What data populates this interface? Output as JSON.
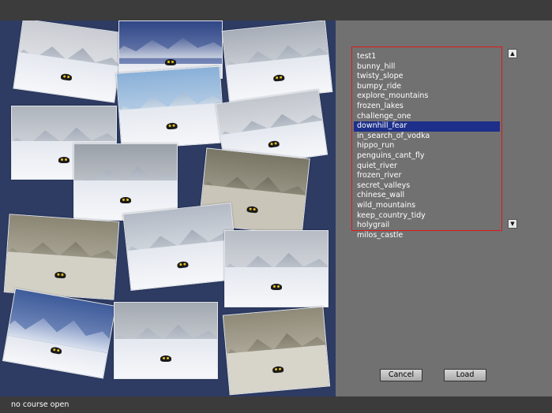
{
  "courses": {
    "items": [
      "test1",
      "bunny_hill",
      "twisty_slope",
      "bumpy_ride",
      "explore_mountains",
      "frozen_lakes",
      "challenge_one",
      "downhill_fear",
      "in_search_of_vodka",
      "hippo_run",
      "penguins_cant_fly",
      "quiet_river",
      "frozen_river",
      "secret_valleys",
      "chinese_wall",
      "wild_mountains",
      "keep_country_tidy",
      "holygrail",
      "milos_castle"
    ],
    "selected_index": 7
  },
  "scroll": {
    "up_icon": "triangle-up-icon",
    "down_icon": "triangle-down-icon",
    "up_glyph": "▲",
    "down_glyph": "▼"
  },
  "buttons": {
    "cancel": "Cancel",
    "load": "Load"
  },
  "status": {
    "text": "no course open"
  },
  "colors": {
    "collage_bg": "#2e3c64",
    "panel_bg": "#717171",
    "selection": "#1d2f8a",
    "list_border": "#e01818",
    "bar": "#3b3b3b"
  }
}
